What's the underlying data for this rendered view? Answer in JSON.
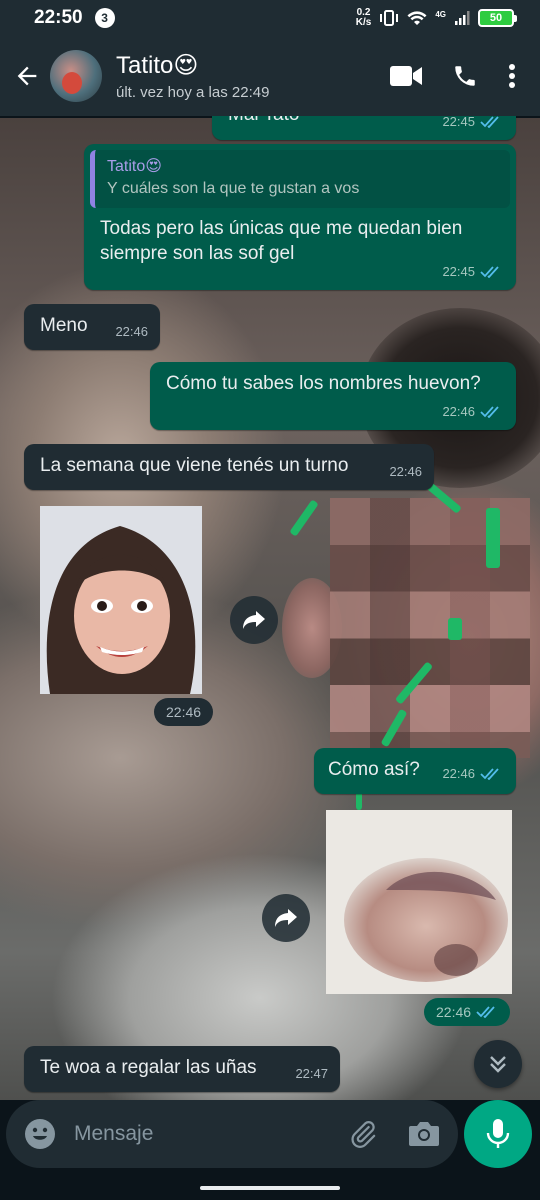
{
  "status_bar": {
    "time": "22:50",
    "notification_count": "3",
    "net_speed": "0.2",
    "net_unit": "K/s",
    "network": "4G",
    "battery": "50"
  },
  "header": {
    "contact_name": "Tatito😍",
    "last_seen": "últ. vez hoy a las 22:49"
  },
  "messages": {
    "m0": {
      "text": "Mal Tato",
      "time": "22:45"
    },
    "m1": {
      "quote_name": "Tatito😍",
      "quote_text": "Y cuáles son la que te gustan a vos",
      "text": "Todas pero las únicas que me quedan bien siempre son las sof gel",
      "time": "22:45"
    },
    "m2": {
      "text": "Meno",
      "time": "22:46"
    },
    "m3": {
      "text": "Cómo tu sabes los nombres huevon?",
      "time": "22:46"
    },
    "m4": {
      "text": "La semana que viene tenés un turno",
      "time": "22:46"
    },
    "m5": {
      "time": "22:46"
    },
    "m6": {
      "text": "Cómo así?",
      "time": "22:46"
    },
    "m7": {
      "time": "22:46"
    },
    "m8": {
      "text": "Te woa a regalar las uñas",
      "time": "22:47"
    }
  },
  "input": {
    "placeholder": "Mensaje"
  },
  "colors": {
    "header_bg": "#1f2c33",
    "outgoing_bubble": "#005c4b",
    "incoming_bubble": "#202c33",
    "accent": "#00a884",
    "read_ticks": "#53bdeb"
  },
  "icons": [
    "back-arrow-icon",
    "video-call-icon",
    "phone-icon",
    "more-vert-icon",
    "forward-icon",
    "double-check-icon",
    "chevron-double-down-icon",
    "emoji-icon",
    "attach-icon",
    "camera-icon",
    "mic-icon"
  ]
}
